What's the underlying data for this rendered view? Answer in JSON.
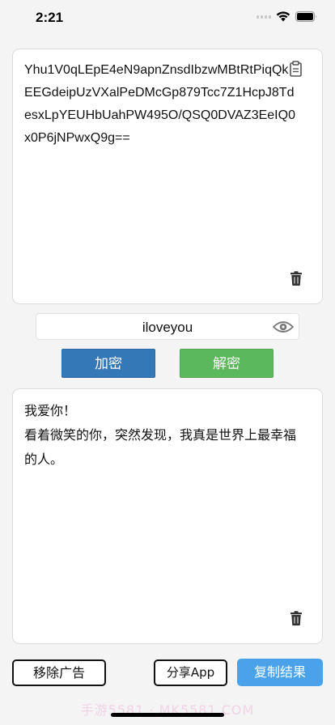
{
  "status_bar": {
    "time": "2:21"
  },
  "input": {
    "text": "Yhu1V0qLEpE4eN9apnZnsdIbzwMBtRtPiqQkEEGdeipUzVXalPeDMcGp879Tcc7Z1HcpJ8TdesxLpYEUHbUahPW495O/QSQ0DVAZ3EeIQ0x0P6jNPwxQ9g==",
    "paste_icon": "paste-icon",
    "delete_icon": "trash-icon"
  },
  "key": {
    "value": "iloveyou",
    "toggle_icon": "eye-icon"
  },
  "actions": {
    "encrypt_label": "加密",
    "decrypt_label": "解密"
  },
  "output": {
    "text": "我爱你！\n看着微笑的你，突然发现，我真是世界上最幸福的人。",
    "delete_icon": "trash-icon"
  },
  "footer": {
    "remove_ads_label": "移除广告",
    "share_label": "分享App",
    "copy_label": "复制结果"
  },
  "watermark": "手游5581 · MK5581.COM",
  "colors": {
    "encrypt": "#3478b7",
    "decrypt": "#5cb85c",
    "copy": "#4aa3ea",
    "background": "#f4f4f4"
  }
}
